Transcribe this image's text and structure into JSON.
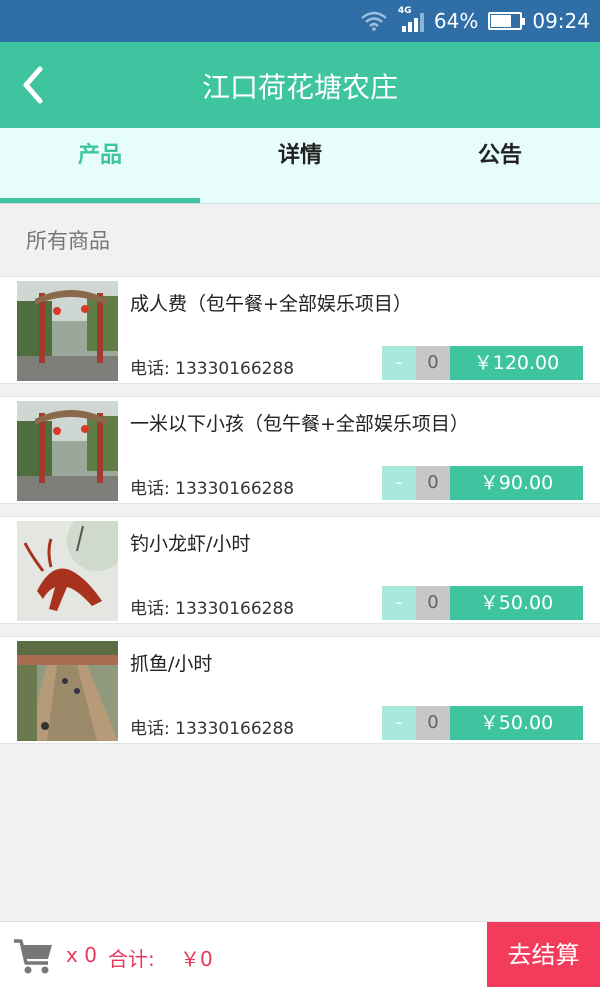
{
  "status_bar": {
    "network": "4G",
    "battery": "64%",
    "battery_level": 0.64,
    "time": "09:24"
  },
  "header": {
    "title": "江口荷花塘农庄"
  },
  "tabs": [
    {
      "label": "产品",
      "active": true
    },
    {
      "label": "详情",
      "active": false
    },
    {
      "label": "公告",
      "active": false
    }
  ],
  "section": {
    "label": "所有商品"
  },
  "products": [
    {
      "name": "成人费（包午餐+全部娱乐项目）",
      "phone": "电话: 13330166288",
      "minus": "-",
      "qty": "0",
      "price": "￥120.00"
    },
    {
      "name": "一米以下小孩（包午餐+全部娱乐项目）",
      "phone": "电话: 13330166288",
      "minus": "-",
      "qty": "0",
      "price": "￥90.00"
    },
    {
      "name": "钓小龙虾/小时",
      "phone": "电话: 13330166288",
      "minus": "-",
      "qty": "0",
      "price": "￥50.00"
    },
    {
      "name": "抓鱼/小时",
      "phone": "电话: 13330166288",
      "minus": "-",
      "qty": "0",
      "price": "￥50.00"
    }
  ],
  "bottom": {
    "count": "x 0",
    "total_label": "合计:",
    "total_value": "￥0",
    "checkout": "去结算"
  },
  "colors": {
    "primary": "#3ec59f",
    "status": "#2f6ea6",
    "accent": "#f33c5b",
    "tabs_bg": "#e6fdfb"
  }
}
